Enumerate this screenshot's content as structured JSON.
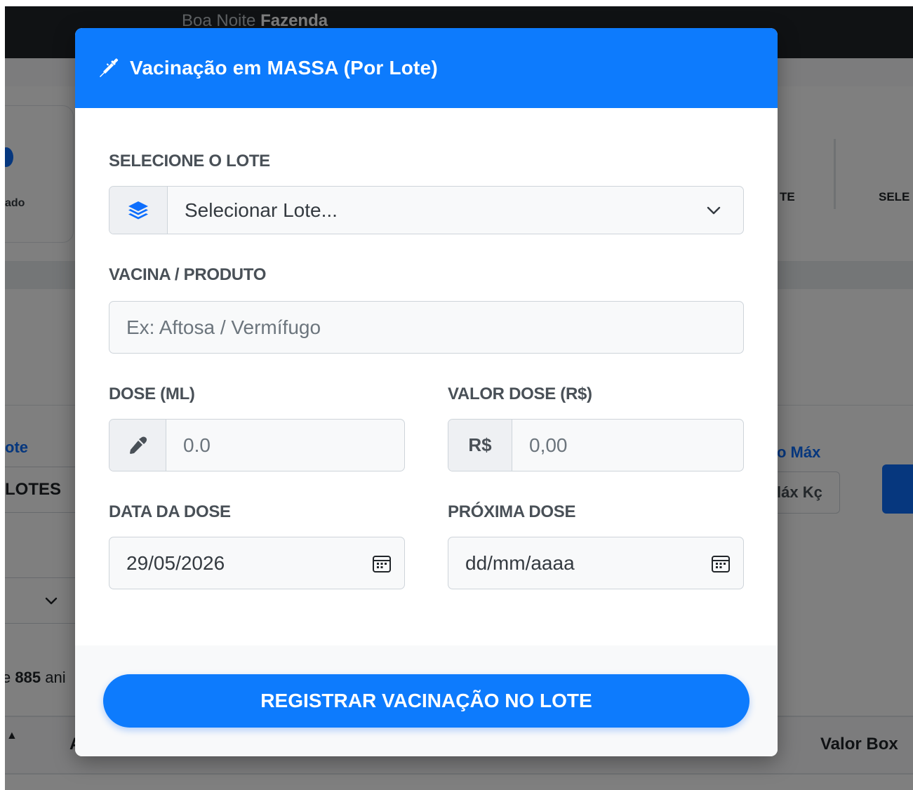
{
  "background": {
    "greeting_prefix": "Boa Noite",
    "greeting_name": "Fazenda",
    "card_label": "ado",
    "stat_te": "TE",
    "stat_sel": "SELE",
    "lote_link": "ote",
    "lotes_value": "LOTES",
    "max_link": "o Máx",
    "max_value": "láx Kç",
    "count_prefix": "e",
    "count_value": "885",
    "count_suffix": "ani",
    "col_a": "A",
    "col_valor": "Valor Box"
  },
  "modal": {
    "title": "Vacinação em MASSA (Por Lote)",
    "header_icon": "syringe-icon",
    "lote": {
      "label": "SELECIONE O LOTE",
      "icon": "layers-icon",
      "value": "Selecionar Lote..."
    },
    "vacina": {
      "label": "VACINA / PRODUTO",
      "placeholder": "Ex: Aftosa / Vermífugo"
    },
    "dose": {
      "label": "DOSE (ML)",
      "icon": "eyedropper-icon",
      "placeholder": "0.0"
    },
    "valor": {
      "label": "VALOR DOSE (R$)",
      "prefix": "R$",
      "placeholder": "0,00"
    },
    "data_dose": {
      "label": "DATA DA DOSE",
      "value": "29/05/2026"
    },
    "proxima_dose": {
      "label": "PRÓXIMA DOSE",
      "placeholder": "dd/mm/aaaa"
    },
    "submit_label": "REGISTRAR VACINAÇÃO NO LOTE"
  },
  "colors": {
    "primary": "#0d7bfd",
    "backdrop": "rgba(0,0,0,0.5)"
  }
}
